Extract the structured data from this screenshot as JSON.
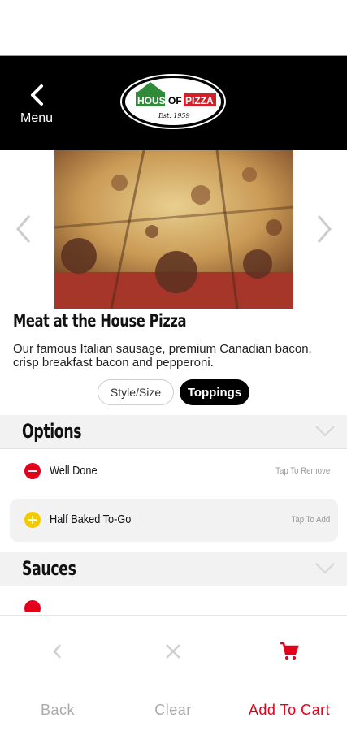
{
  "header": {
    "back_label": "Menu",
    "logo_text_house": "HOUSE",
    "logo_text_of": "OF",
    "logo_text_pizza": "PIZZA",
    "logo_est": "Est. 1959"
  },
  "product": {
    "title": "Meat at the House Pizza",
    "description": "Our famous Italian sausage, premium Canadian bacon, crisp breakfast bacon and pepperoni."
  },
  "tabs": [
    {
      "label": "Style/Size",
      "selected": false
    },
    {
      "label": "Toppings",
      "selected": true
    }
  ],
  "options": {
    "title": "Options",
    "items": [
      {
        "label": "Well Done",
        "hint": "Tap To Remove",
        "state": "selected",
        "icon": "minus-circle-icon"
      },
      {
        "label": "Half Baked To-Go",
        "hint": "Tap To Add",
        "state": "unselected",
        "icon": "plus-circle-icon"
      }
    ]
  },
  "sauces": {
    "title": "Sauces"
  },
  "bottom_nav": {
    "back_label": "Back",
    "clear_label": "Clear",
    "cart_label": "Add To Cart"
  },
  "colors": {
    "accent_red": "#e3001b",
    "add_yellow": "#f6c800",
    "header_bg": "#000000",
    "section_bg": "#f2f2f2"
  }
}
